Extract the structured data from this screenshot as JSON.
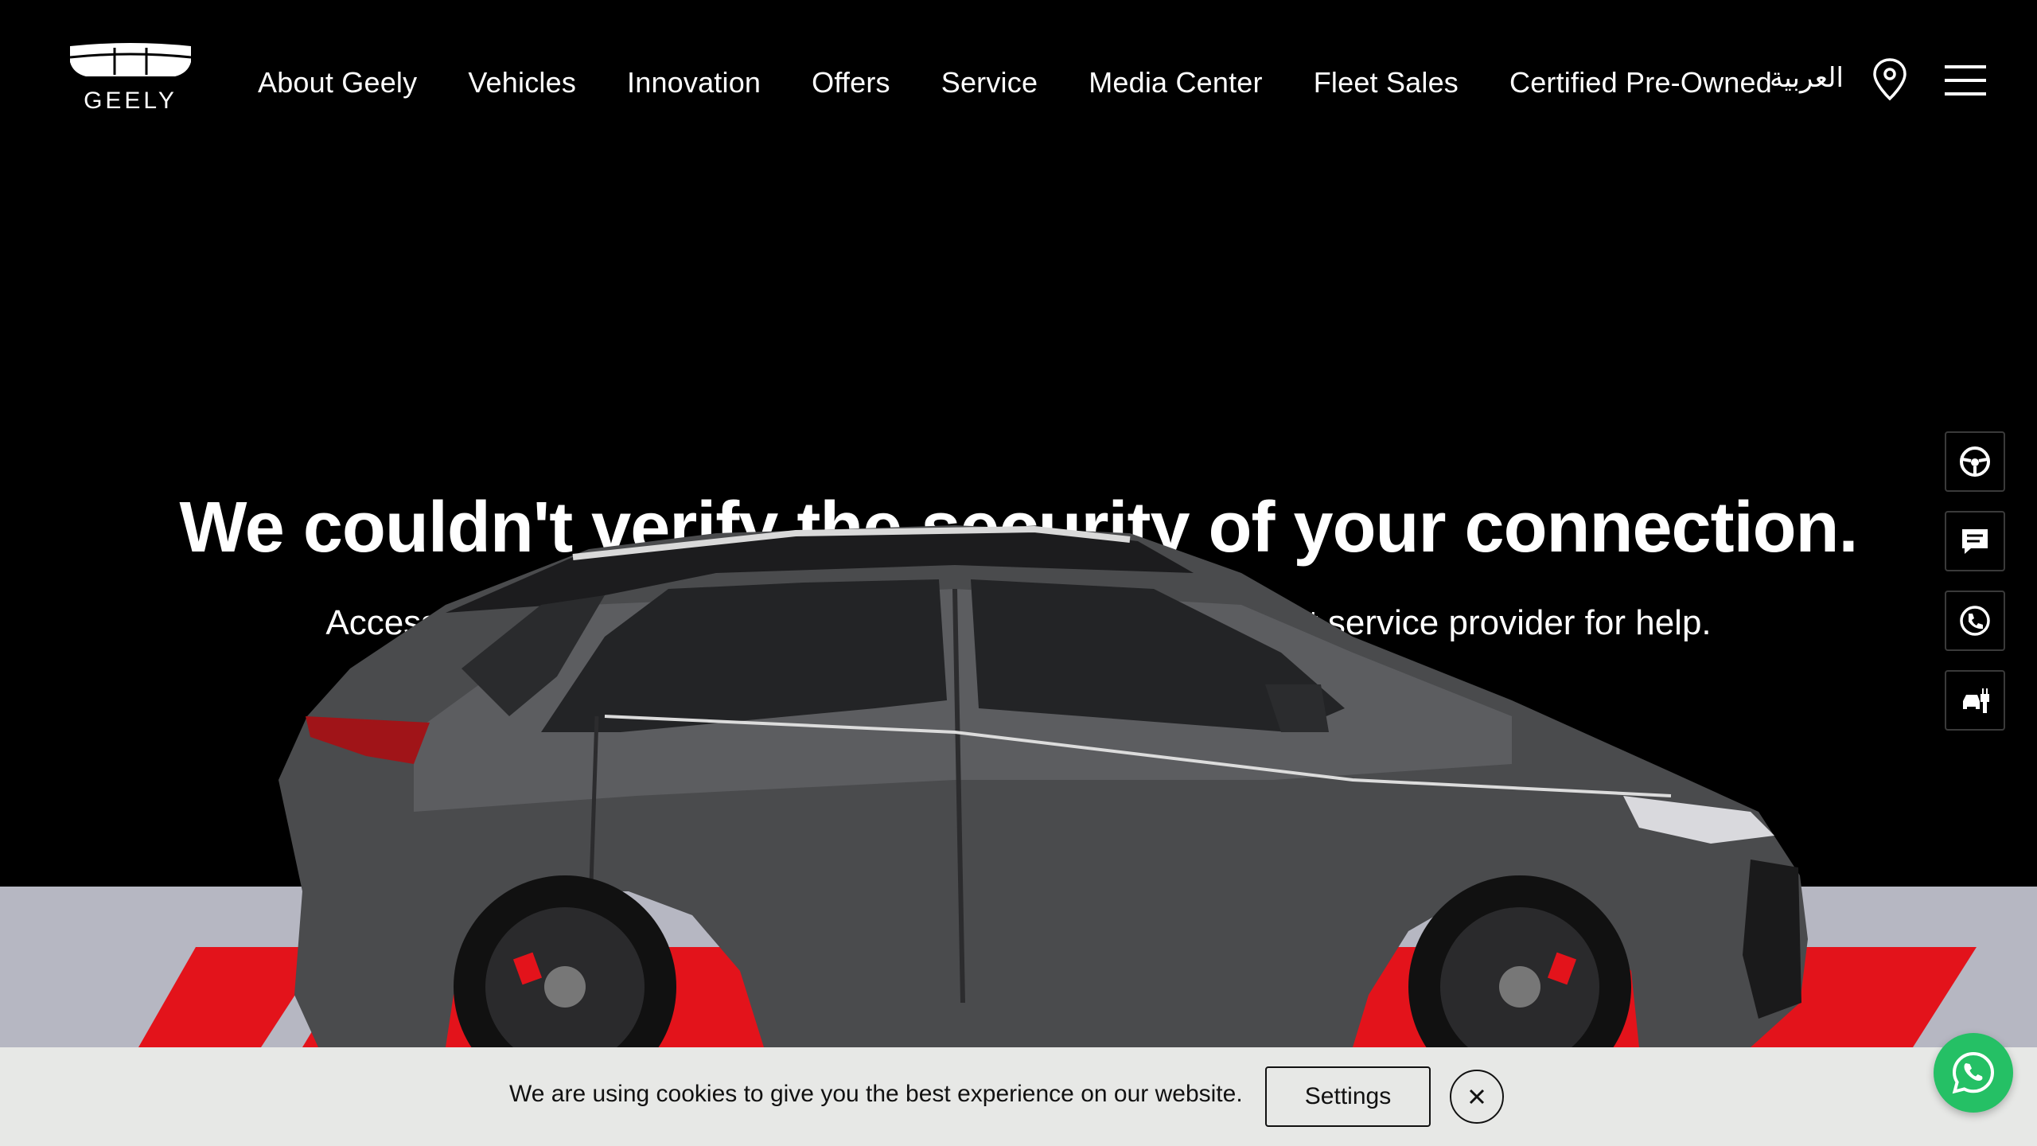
{
  "brand": {
    "name": "GEELY"
  },
  "nav": {
    "items": [
      {
        "label": "About Geely"
      },
      {
        "label": "Vehicles"
      },
      {
        "label": "Innovation"
      },
      {
        "label": "Offers"
      },
      {
        "label": "Service"
      },
      {
        "label": "Media Center"
      },
      {
        "label": "Fleet Sales"
      },
      {
        "label": "Certified Pre-Owned"
      }
    ],
    "language": "العربية"
  },
  "hero": {
    "error_title": "We couldn't verify the security of your connection.",
    "error_subtitle": "Access to this content has been restricted. Contact your internet service provider for help."
  },
  "side_tools": [
    {
      "icon": "steering-wheel-icon"
    },
    {
      "icon": "chat-icon"
    },
    {
      "icon": "phone-icon"
    },
    {
      "icon": "service-tools-icon"
    }
  ],
  "cookie": {
    "message": "We are using cookies to give you the best experience on our website.",
    "settings_label": "Settings"
  },
  "colors": {
    "header_bg": "#000000",
    "cookie_bg": "#e7e8e6",
    "whatsapp_green": "#25c065",
    "stripe_red": "#e3131b"
  }
}
